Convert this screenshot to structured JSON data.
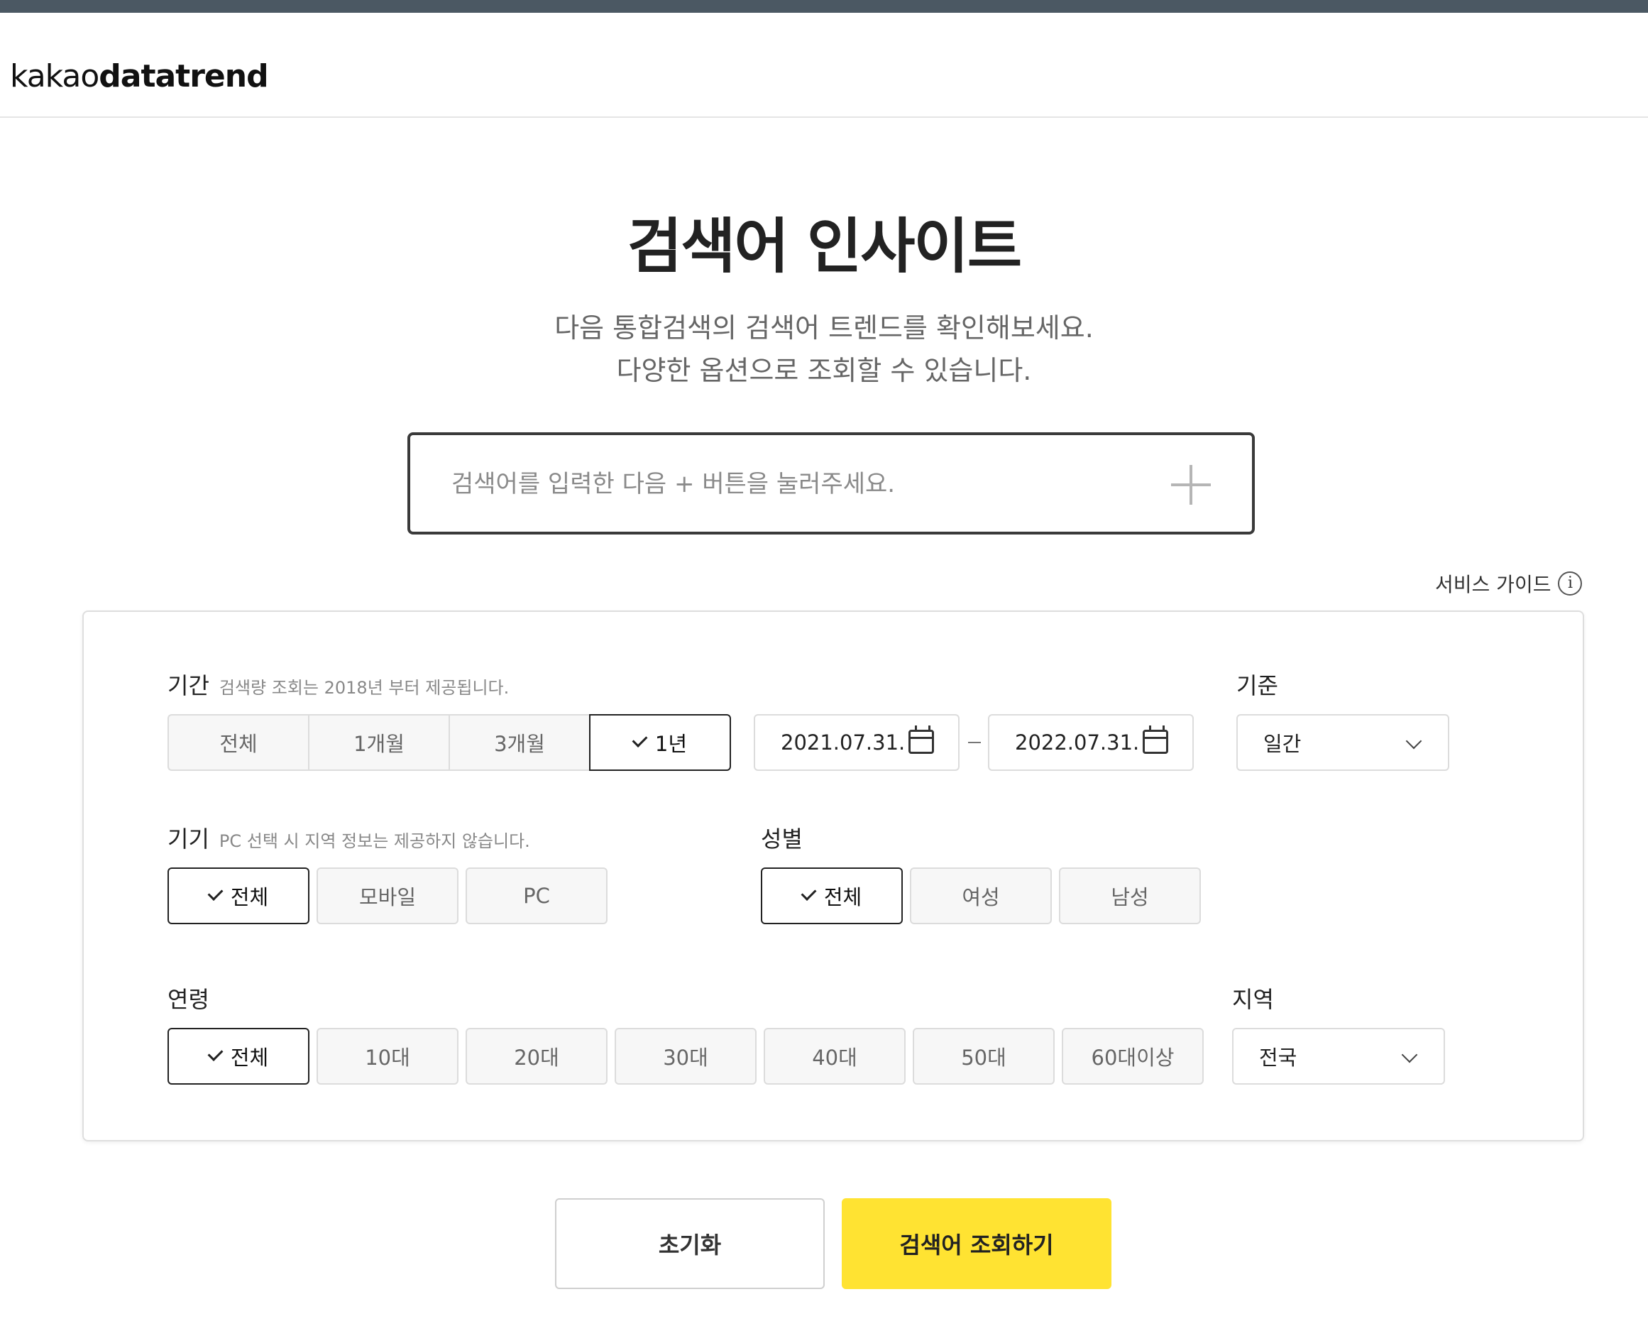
{
  "logo": {
    "light": "kakao",
    "bold": "datatrend"
  },
  "page_title": "검색어 인사이트",
  "subtitle": [
    "다음 통합검색의 검색어 트렌드를 확인해보세요.",
    "다양한 옵션으로 조회할 수 있습니다."
  ],
  "search": {
    "placeholder": "검색어를 입력한 다음 + 버튼을 눌러주세요.",
    "value": ""
  },
  "service_guide": {
    "label": "서비스 가이드",
    "icon": "i"
  },
  "period": {
    "label": "기간",
    "hint": "검색량 조회는 2018년 부터 제공됩니다.",
    "options": [
      "전체",
      "1개월",
      "3개월",
      "1년"
    ],
    "selected": "1년",
    "start_date": "2021.07.31.",
    "end_date": "2022.07.31."
  },
  "basis": {
    "label": "기준",
    "value": "일간"
  },
  "device": {
    "label": "기기",
    "hint": "PC 선택 시 지역 정보는 제공하지 않습니다.",
    "options": [
      "전체",
      "모바일",
      "PC"
    ],
    "selected": "전체"
  },
  "gender": {
    "label": "성별",
    "options": [
      "전체",
      "여성",
      "남성"
    ],
    "selected": "전체"
  },
  "age": {
    "label": "연령",
    "options": [
      "전체",
      "10대",
      "20대",
      "30대",
      "40대",
      "50대",
      "60대이상"
    ],
    "selected": "전체"
  },
  "region": {
    "label": "지역",
    "value": "전국"
  },
  "buttons": {
    "reset": "초기화",
    "submit": "검색어 조회하기"
  },
  "colors": {
    "accent_yellow": "#ffe332",
    "topbar": "#4b5863",
    "selected_border": "#222222"
  }
}
